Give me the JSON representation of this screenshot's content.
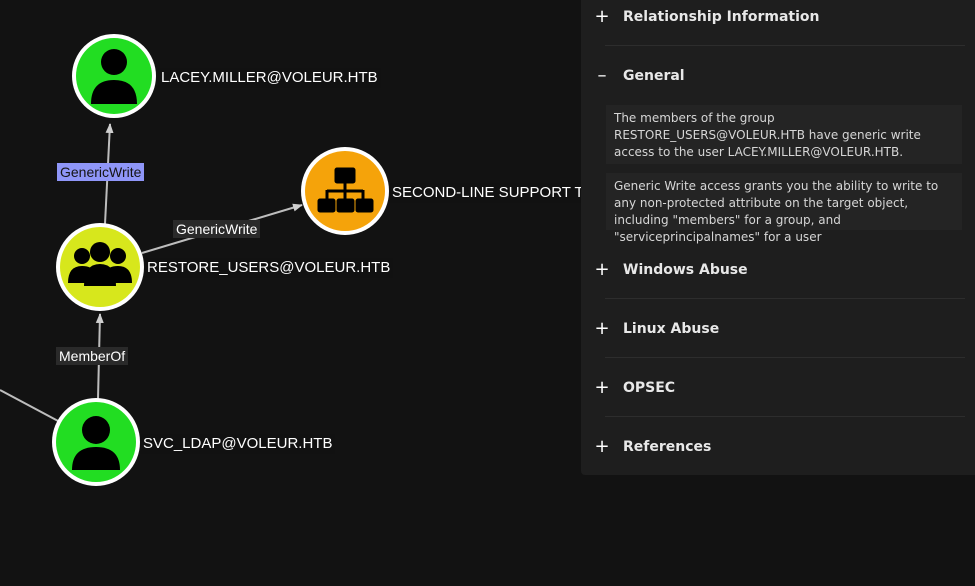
{
  "graph": {
    "nodes": {
      "lacey": {
        "label": "LACEY.MILLER@VOLEUR.HTB",
        "icon": "user-icon",
        "color": "#22dd22"
      },
      "second_line": {
        "label": "SECOND-LINE SUPPORT TE",
        "icon": "organization-icon",
        "color": "#f5a30a"
      },
      "restore_users": {
        "label": "RESTORE_USERS@VOLEUR.HTB",
        "icon": "group-icon",
        "color": "#d7e71c"
      },
      "svc_ldap": {
        "label": "SVC_LDAP@VOLEUR.HTB",
        "icon": "user-icon",
        "color": "#22dd22"
      }
    },
    "edges": {
      "restore_to_lacey": "GenericWrite",
      "restore_to_second_line": "GenericWrite",
      "svc_to_restore": "MemberOf"
    },
    "selected_edge_color": "#8f96f8"
  },
  "panel": {
    "sections": [
      {
        "title": "Relationship Information",
        "expanded": false,
        "toggle": "+"
      },
      {
        "title": "General",
        "expanded": true,
        "toggle": "–"
      },
      {
        "title": "Windows Abuse",
        "expanded": false,
        "toggle": "+"
      },
      {
        "title": "Linux Abuse",
        "expanded": false,
        "toggle": "+"
      },
      {
        "title": "OPSEC",
        "expanded": false,
        "toggle": "+"
      },
      {
        "title": "References",
        "expanded": false,
        "toggle": "+"
      }
    ],
    "general": {
      "paragraph1": "The members of the group RESTORE_USERS@VOLEUR.HTB have generic write access to the user LACEY.MILLER@VOLEUR.HTB.",
      "paragraph2": "Generic Write access grants you the ability to write to any non-protected attribute on the target object, including \"members\" for a group, and \"serviceprincipalnames\" for a user"
    }
  }
}
